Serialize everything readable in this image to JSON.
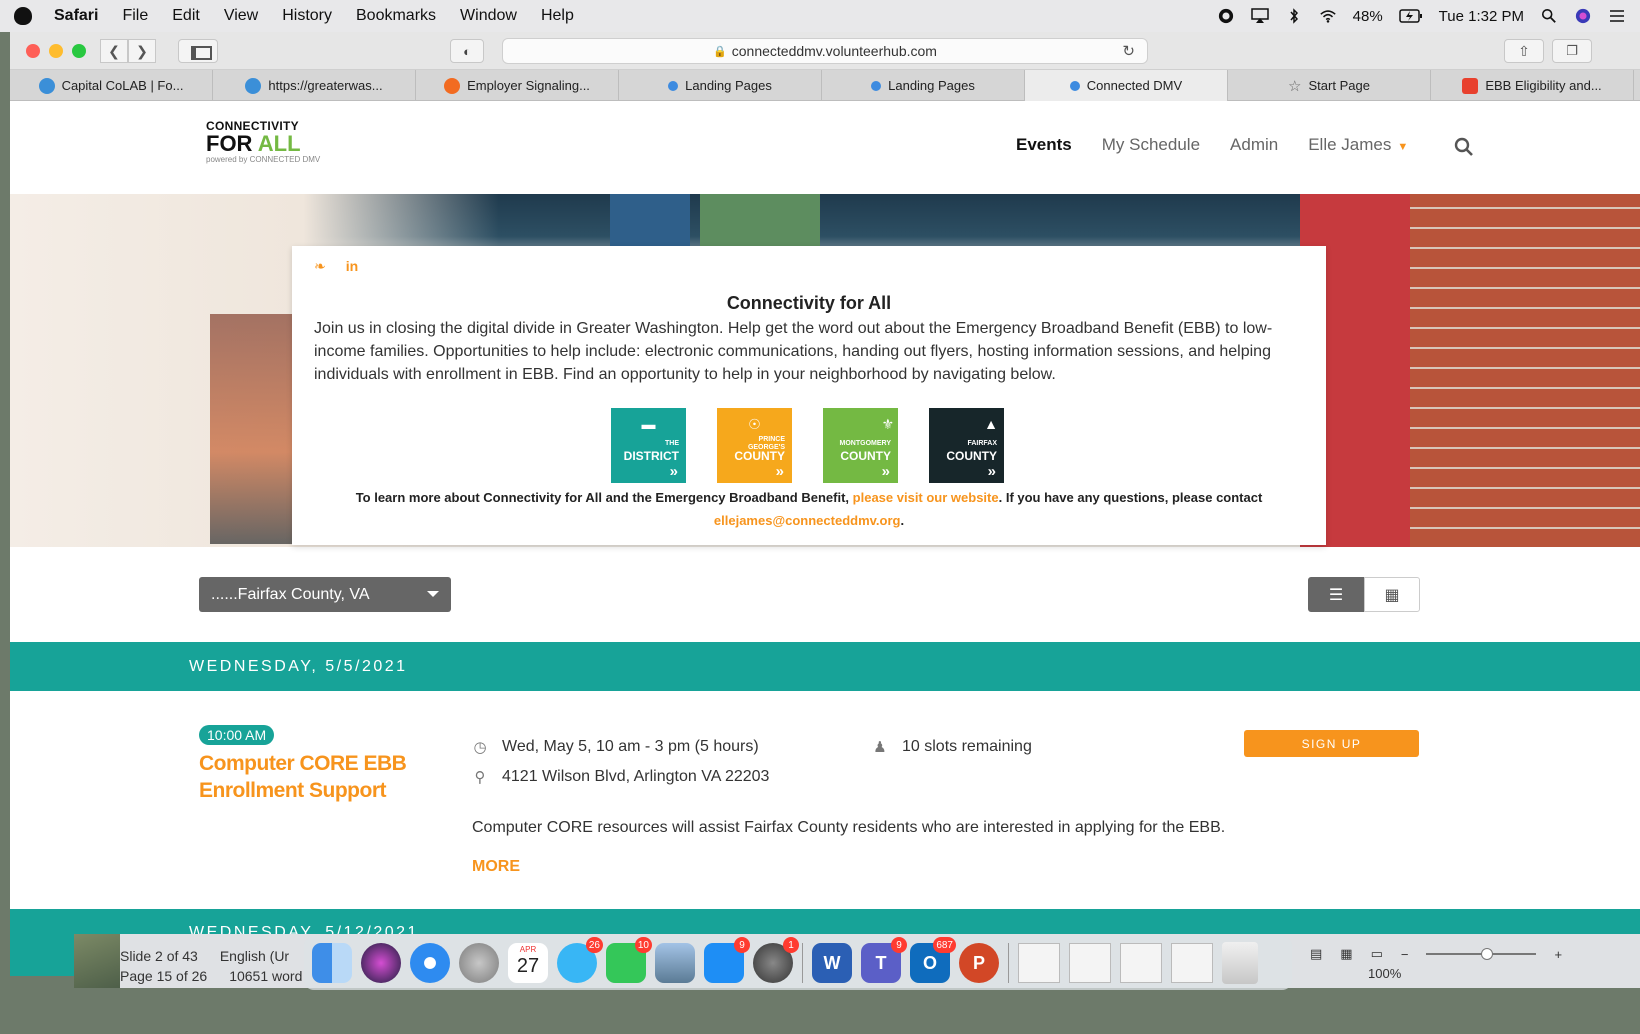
{
  "menubar": {
    "items": [
      "Safari",
      "File",
      "Edit",
      "View",
      "History",
      "Bookmarks",
      "Window",
      "Help"
    ],
    "battery": "48%",
    "clock": "Tue 1:32 PM"
  },
  "browser": {
    "url": "connecteddmv.volunteerhub.com",
    "tabs": [
      {
        "label": "Capital CoLAB | Fo...",
        "color": "#3b8fd8"
      },
      {
        "label": "https://greaterwas...",
        "color": "#3b8fd8"
      },
      {
        "label": "Employer Signaling...",
        "color": "#f26b21"
      },
      {
        "label": "Landing Pages",
        "color": "#3d8be0"
      },
      {
        "label": "Landing Pages",
        "color": "#3d8be0"
      },
      {
        "label": "Connected DMV",
        "color": "#3d8be0"
      },
      {
        "label": "Start Page",
        "color": "#777777"
      },
      {
        "label": "EBB Eligibility and...",
        "color": "#e8412e"
      }
    ]
  },
  "site": {
    "logo": {
      "line1": "CONNECTIVITY",
      "line2a": "FOR",
      "line2b": "ALL",
      "line3": "powered by CONNECTED DMV"
    },
    "nav": {
      "events": "Events",
      "schedule": "My Schedule",
      "admin": "Admin",
      "user": "Elle James"
    },
    "card": {
      "title": "Connectivity for All",
      "body": "Join us in closing the digital divide in Greater Washington. Help get the word out about the Emergency Broadband Benefit (EBB) to low-income families. Opportunities to help include: electronic communications, handing out flyers, hosting information sessions, and helping individuals with enrollment in EBB. Find an opportunity to help in your neighborhood by navigating below.",
      "counties": [
        {
          "top": "THE",
          "name": "DISTRICT",
          "color": "#17a398"
        },
        {
          "top": "PRINCE GEORGE'S",
          "name": "COUNTY",
          "color": "#f6a81c"
        },
        {
          "top": "MONTGOMERY",
          "name": "COUNTY",
          "color": "#74b943"
        },
        {
          "top": "FAIRFAX",
          "name": "COUNTY",
          "color": "#17262a"
        }
      ],
      "foot_a": "To learn more about Connectivity for All and the Emergency Broadband Benefit, ",
      "foot_link": "please visit our website",
      "foot_b": ". If you have any questions, please contact",
      "foot_email": "ellejames@connecteddmv.org",
      "foot_end": "."
    },
    "filter": {
      "selected": "......Fairfax County, VA"
    },
    "date1": "WEDNESDAY, 5/5/2021",
    "date2": "WEDNESDAY, 5/12/2021",
    "event": {
      "time": "10:00 AM",
      "title": "Computer CORE EBB Enrollment Support",
      "when": "Wed, May 5, 10 am - 3 pm (5 hours)",
      "where": "4121 Wilson Blvd, Arlington VA 22203",
      "slots": "10 slots remaining",
      "signup": "SIGN UP",
      "description": "Computer CORE resources will assist Fairfax County residents who are interested in applying for the EBB.",
      "more": "MORE"
    }
  },
  "word": {
    "slide": "Slide 2 of 43",
    "lang": "English (Ur",
    "page": "Page 15 of 26",
    "words": "10651 word",
    "zoom": "100%"
  },
  "dock": {
    "calendar_month": "APR",
    "calendar_day": "27",
    "badges": {
      "messages": "26",
      "facetime": "10",
      "appstore": "9",
      "settings": "1",
      "teams": "9",
      "outlook": "687"
    }
  }
}
